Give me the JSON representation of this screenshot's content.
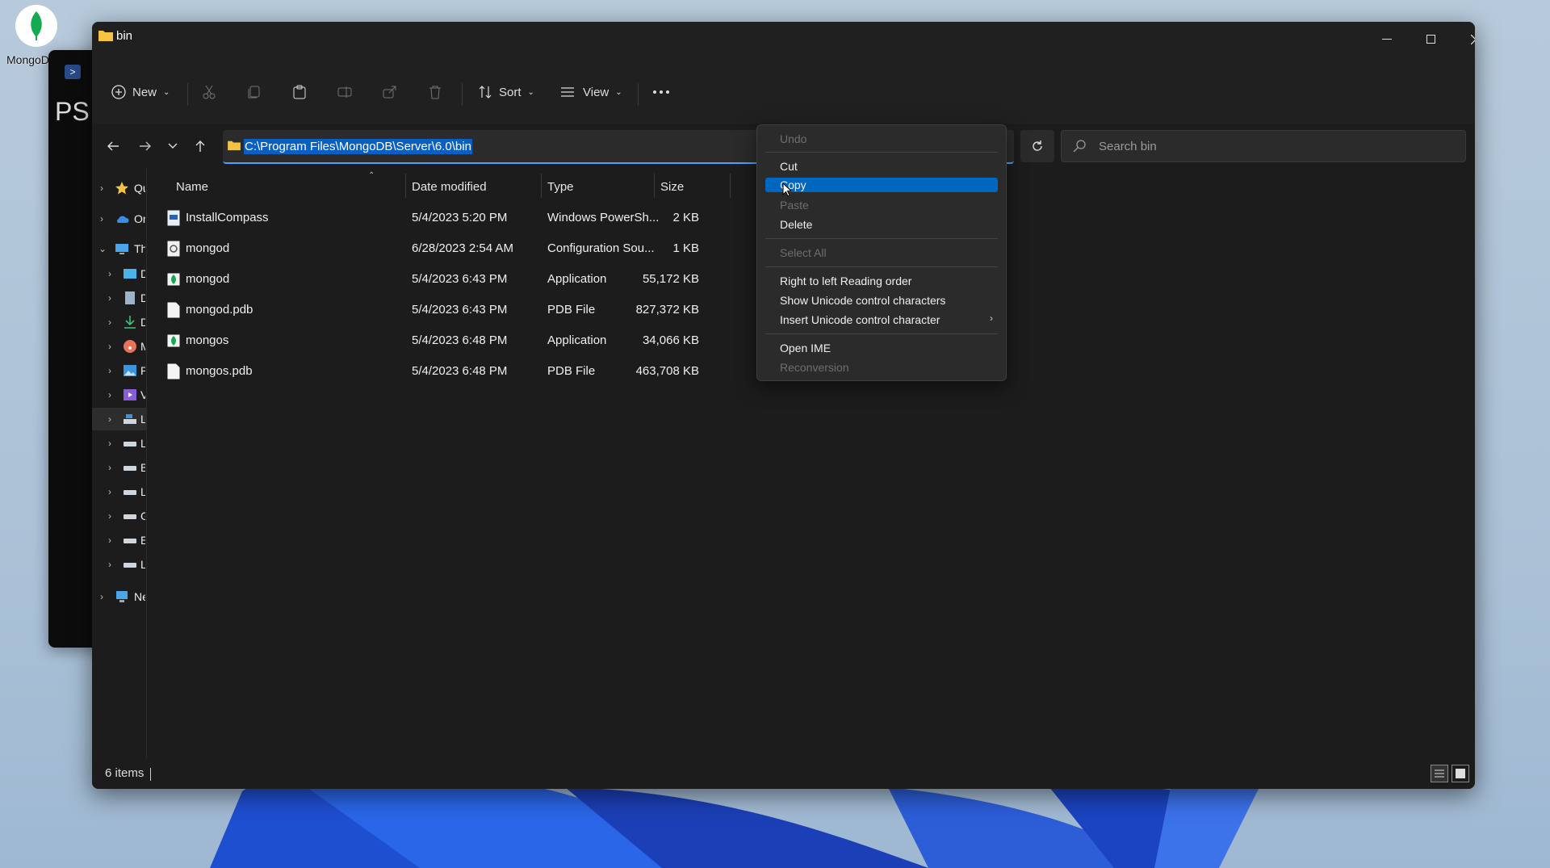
{
  "desktop": {
    "icon_label": "MongoDB",
    "powershell_text": "PS"
  },
  "window": {
    "title": "bin"
  },
  "toolbar": {
    "new_label": "New",
    "sort_label": "Sort",
    "view_label": "View"
  },
  "address": {
    "path": "C:\\Program Files\\MongoDB\\Server\\6.0\\bin"
  },
  "search": {
    "placeholder": "Search bin"
  },
  "sidebar": {
    "items": [
      {
        "label": "Quick access"
      },
      {
        "label": "OneDrive"
      },
      {
        "label": "This PC"
      },
      {
        "label": "Desktop"
      },
      {
        "label": "Documents"
      },
      {
        "label": "Downloads"
      },
      {
        "label": "Music"
      },
      {
        "label": "Pictures"
      },
      {
        "label": "Videos"
      },
      {
        "label": "Local Disk"
      },
      {
        "label": "Local Disk"
      },
      {
        "label": "Backup"
      },
      {
        "label": "Local Disk"
      },
      {
        "label": "Games"
      },
      {
        "label": "Extra"
      },
      {
        "label": "Local"
      },
      {
        "label": "Network"
      }
    ]
  },
  "columns": {
    "name": "Name",
    "date": "Date modified",
    "type": "Type",
    "size": "Size"
  },
  "files": [
    {
      "name": "InstallCompass",
      "date": "5/4/2023 5:20 PM",
      "type": "Windows PowerSh...",
      "size": "2 KB"
    },
    {
      "name": "mongod",
      "date": "6/28/2023 2:54 AM",
      "type": "Configuration Sou...",
      "size": "1 KB"
    },
    {
      "name": "mongod",
      "date": "5/4/2023 6:43 PM",
      "type": "Application",
      "size": "55,172 KB"
    },
    {
      "name": "mongod.pdb",
      "date": "5/4/2023 6:43 PM",
      "type": "PDB File",
      "size": "827,372 KB"
    },
    {
      "name": "mongos",
      "date": "5/4/2023 6:48 PM",
      "type": "Application",
      "size": "34,066 KB"
    },
    {
      "name": "mongos.pdb",
      "date": "5/4/2023 6:48 PM",
      "type": "PDB File",
      "size": "463,708 KB"
    }
  ],
  "status": {
    "count": "6 items"
  },
  "context_menu": {
    "undo": "Undo",
    "cut": "Cut",
    "copy": "Copy",
    "paste": "Paste",
    "delete": "Delete",
    "select_all": "Select All",
    "rtl": "Right to left Reading order",
    "show_unicode": "Show Unicode control characters",
    "insert_unicode": "Insert Unicode control character",
    "open_ime": "Open IME",
    "reconversion": "Reconversion"
  },
  "colors": {
    "accent": "#0067c0",
    "window_bg": "#1c1c1c",
    "toolbar_bg": "#202020"
  }
}
